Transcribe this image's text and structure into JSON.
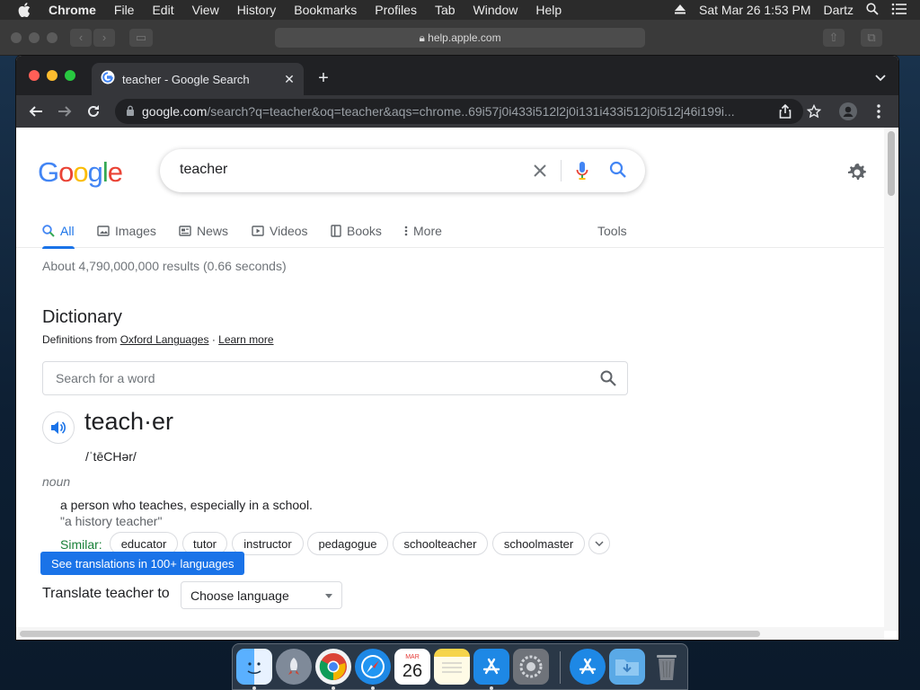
{
  "menubar": {
    "app_name": "Chrome",
    "items": [
      "File",
      "Edit",
      "View",
      "History",
      "Bookmarks",
      "Profiles",
      "Tab",
      "Window",
      "Help"
    ],
    "datetime": "Sat Mar 26  1:53 PM",
    "user": "Dartz"
  },
  "background_window": {
    "url": "help.apple.com"
  },
  "chrome": {
    "tab_title": "teacher - Google Search",
    "omnibox_host": "google.com",
    "omnibox_path": "/search?q=teacher&oq=teacher&aqs=chrome..69i57j0i433i512l2j0i131i433i512j0i512j46i199i..."
  },
  "google": {
    "logo": "Google",
    "query": "teacher",
    "tabs": [
      {
        "label": "All",
        "icon": "search-icon",
        "active": true
      },
      {
        "label": "Images",
        "icon": "image-icon"
      },
      {
        "label": "News",
        "icon": "news-icon"
      },
      {
        "label": "Videos",
        "icon": "video-icon"
      },
      {
        "label": "Books",
        "icon": "book-icon"
      },
      {
        "label": "More",
        "icon": "more-vert-icon"
      }
    ],
    "tools_label": "Tools",
    "stats": "About 4,790,000,000 results (0.66 seconds)"
  },
  "dictionary": {
    "heading": "Dictionary",
    "definitions_from": "Definitions from",
    "source_link": "Oxford Languages",
    "separator": "·",
    "learn_more": "Learn more",
    "search_placeholder": "Search for a word",
    "headword": "teach·er",
    "phonetic": "/ˈtēCHər/",
    "part_of_speech": "noun",
    "definition": "a person who teaches, especially in a school.",
    "example": "\"a history teacher\"",
    "similar_label": "Similar:",
    "similar": [
      "educator",
      "tutor",
      "instructor",
      "pedagogue",
      "schoolteacher",
      "schoolmaster"
    ],
    "translate_button": "See translations in 100+ languages",
    "translate_label": "Translate teacher to",
    "language_select": "Choose language"
  },
  "dock": {
    "apps": [
      "finder",
      "launchpad",
      "chrome",
      "safari",
      "calendar",
      "notes",
      "app-store",
      "system-preferences",
      "app-store-alt",
      "downloads-folder",
      "trash"
    ],
    "calendar_month": "MAR",
    "calendar_day": "26"
  },
  "colors": {
    "accent_blue": "#1a73e8",
    "similar_green": "#188038",
    "chrome_dark": "#202124"
  }
}
